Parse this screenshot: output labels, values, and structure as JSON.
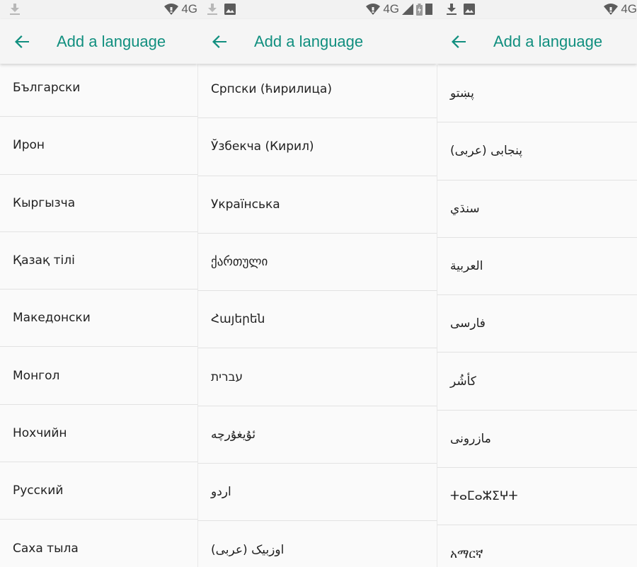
{
  "theme": {
    "accent": "#118f7f",
    "status_icon": "#5c5c5c"
  },
  "screens": [
    {
      "status": {
        "left_icons": [
          "download-icon"
        ],
        "network": "4G"
      },
      "title": "Add a language",
      "languages": [
        "Български",
        "Ирон",
        "Кыргызча",
        "Қазақ тілі",
        "Македонски",
        "Монгол",
        "Нохчийн",
        "Русский",
        "Саха тыла"
      ]
    },
    {
      "status": {
        "left_icons": [
          "download-icon",
          "image-icon"
        ],
        "network": "4G"
      },
      "title": "Add a language",
      "languages": [
        "Српски (ћирилица)",
        "Ўзбекча (Кирил)",
        "Українська",
        "ქართული",
        "Հայերեն",
        "עברית",
        "ئۇيغۇرچە",
        "اردو",
        "اوزبیک (عربی)"
      ]
    },
    {
      "status": {
        "left_icons": [
          "download-icon",
          "image-icon"
        ],
        "network": "4G"
      },
      "title": "Add a language",
      "languages": [
        "پښتو",
        "پنجابی (عربی)",
        "سنڌي",
        "العربية",
        "فارسی",
        "کأشُر",
        "مازرونی",
        "ⵜⴰⵎⴰⵣⵉⵖⵜ",
        "አማርኛ"
      ]
    }
  ]
}
